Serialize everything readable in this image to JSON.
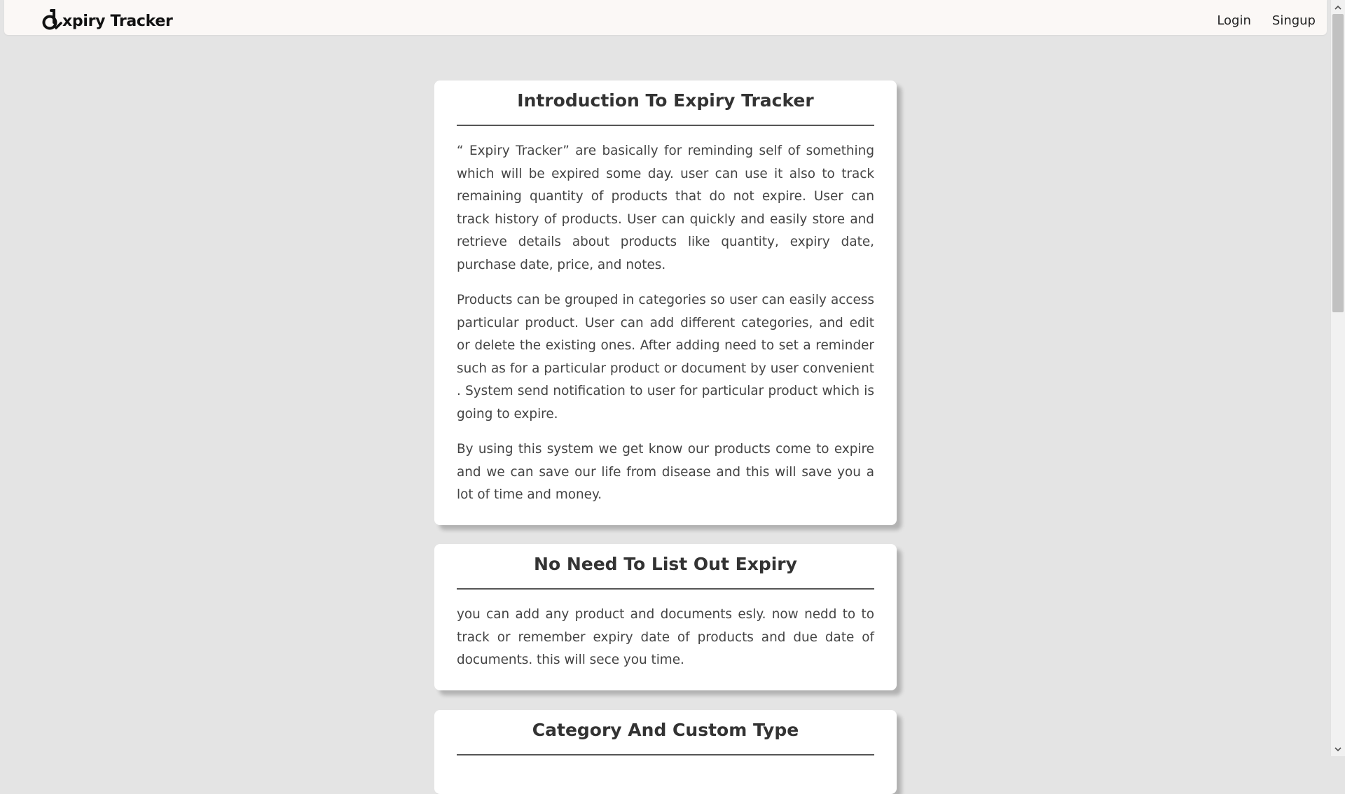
{
  "navbar": {
    "brand_text": "xpiry Tracker",
    "logo_icon": "expiry-tracker-logo",
    "links": [
      {
        "label": "Login"
      },
      {
        "label": "Singup"
      }
    ]
  },
  "cards": [
    {
      "title": "Introduction To Expiry Tracker",
      "paragraphs": [
        "“ Expiry Tracker” are basically for reminding self of something which will be expired some day. user can use it also to track remaining quantity of products that do not expire. User can track history of products. User can quickly and easily store and retrieve details about products like quantity, expiry date, purchase date, price, and notes.",
        "Products can be grouped in categories so user can easily access particular product. User can add different categories, and edit or delete the existing ones. After adding need to set a reminder such as for a particular product or document by user convenient . System send notification to user for particular product which is going to expire.",
        "By using this system we get know our products come to expire and we can save our life from disease and this will save you a lot of time and money."
      ]
    },
    {
      "title": "No Need To List Out Expiry",
      "paragraphs": [
        "you can add any product and documents esly. now nedd to to track or remember expiry date of products and due date of documents. this will sece you time."
      ]
    },
    {
      "title": "Category And Custom Type",
      "paragraphs": []
    }
  ],
  "colors": {
    "page_background": "#e4e4e4",
    "navbar_background": "#fbf8f6",
    "card_background": "#ffffff",
    "text": "#444444"
  }
}
